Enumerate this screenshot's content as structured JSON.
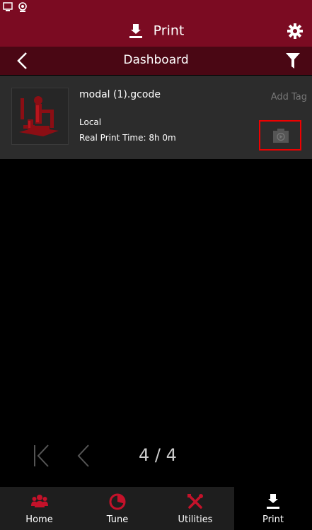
{
  "header": {
    "title": "Print"
  },
  "subbar": {
    "title": "Dashboard"
  },
  "file": {
    "name": "modal (1).gcode",
    "add_tag": "Add Tag",
    "location": "Local",
    "print_time": "Real Print Time: 8h 0m"
  },
  "pager": {
    "page_text": "4 / 4"
  },
  "tabs": [
    {
      "label": "Home",
      "icon": "people-icon"
    },
    {
      "label": "Tune",
      "icon": "tune-icon"
    },
    {
      "label": "Utilities",
      "icon": "tools-icon"
    },
    {
      "label": "Print",
      "icon": "print-icon",
      "active": true
    }
  ],
  "colors": {
    "accent": "#7b0b22",
    "accent_dark": "#4a0714",
    "highlight": "#e00000",
    "card": "#2c2c2c"
  }
}
